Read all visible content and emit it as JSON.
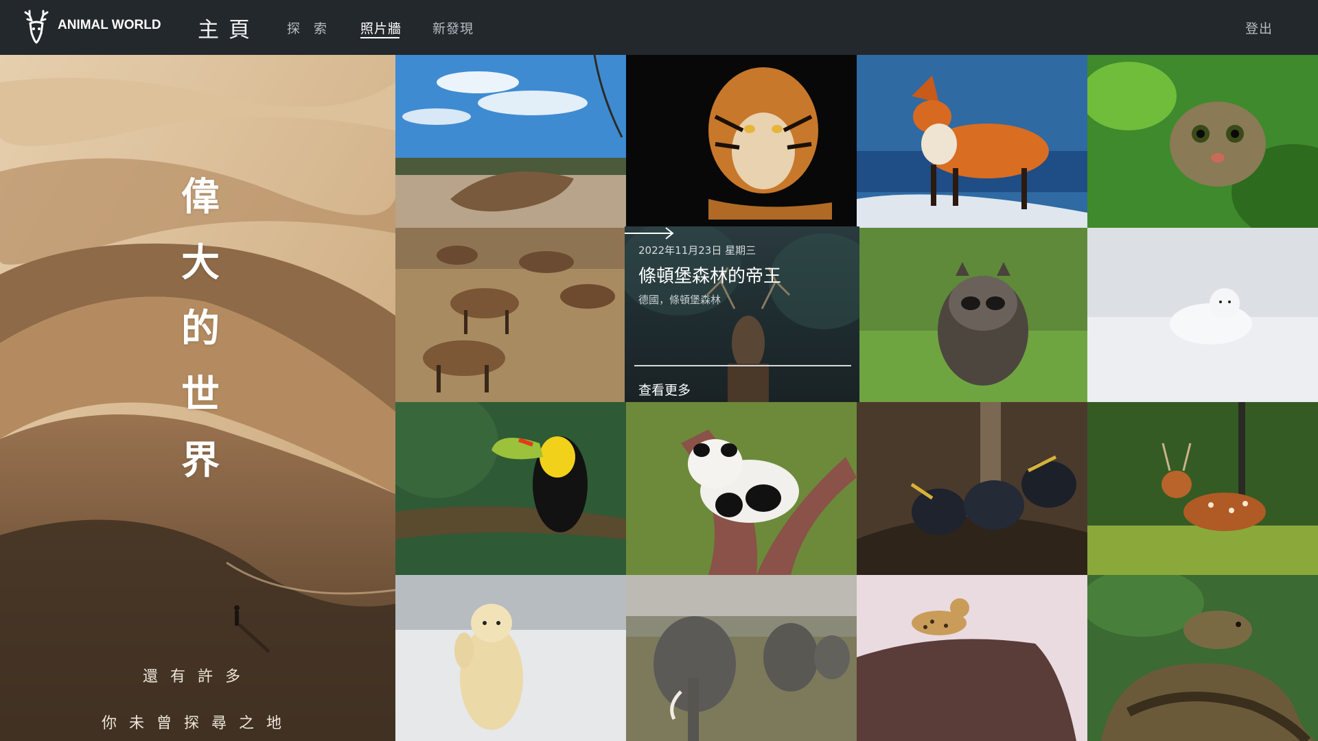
{
  "app": {
    "brand": "ANIMAL WORLD"
  },
  "nav": {
    "home": "主頁",
    "explore": "探索",
    "photo_wall": "照片牆",
    "discover": "新發現",
    "logout": "登出"
  },
  "hero": {
    "title_chars": [
      "偉",
      "大",
      "的",
      "世",
      "界"
    ],
    "subtitle_line1": "還有許多",
    "subtitle_line2": "你未曾探尋之地"
  },
  "feature": {
    "date": "2022年11月23日 星期三",
    "title": "條頓堡森林的帝王",
    "location": "德國，條頓堡森林",
    "more": "查看更多"
  },
  "photos": [
    "pangolin",
    "tiger",
    "red-fox",
    "leopard-cat",
    "elk-herd",
    "stag",
    "raccoon",
    "arctic-fox",
    "toucan",
    "panda",
    "bird-nestlings",
    "spotted-deer",
    "polar-bear",
    "elephants",
    "leopard-on-rock",
    "python"
  ]
}
